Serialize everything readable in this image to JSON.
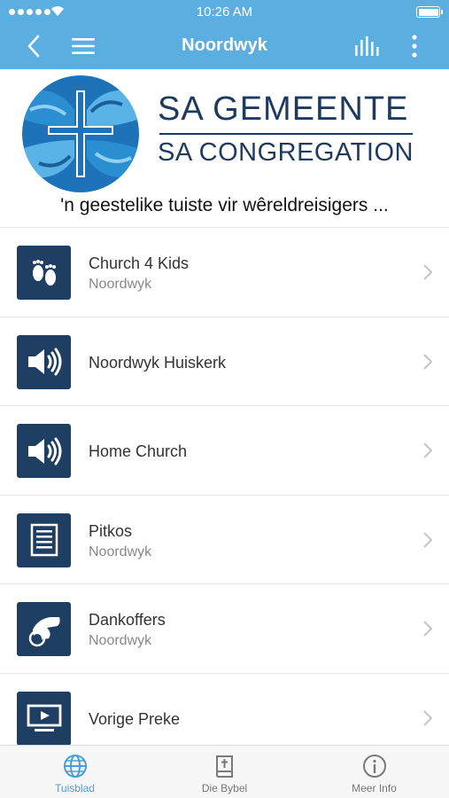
{
  "status_bar": {
    "time": "10:26 AM"
  },
  "nav": {
    "title": "Noordwyk",
    "icons": [
      "back-chevron-icon",
      "hamburger-menu-icon",
      "bar-chart-icon",
      "more-vertical-icon"
    ]
  },
  "header": {
    "brand_line1": "SA GEMEENTE",
    "brand_line2": "SA CONGREGATION",
    "tagline": "'n geestelike tuiste vir wêreldreisigers ..."
  },
  "list": [
    {
      "title": "Church 4 Kids",
      "subtitle": "Noordwyk",
      "icon": "footprints-icon"
    },
    {
      "title": "Noordwyk Huiskerk",
      "subtitle": "",
      "icon": "speaker-icon"
    },
    {
      "title": "Home Church",
      "subtitle": "",
      "icon": "speaker-icon"
    },
    {
      "title": "Pitkos",
      "subtitle": "Noordwyk",
      "icon": "document-icon"
    },
    {
      "title": "Dankoffers",
      "subtitle": "Noordwyk",
      "icon": "giving-hand-icon"
    },
    {
      "title": "Vorige Preke",
      "subtitle": "",
      "icon": "video-screen-icon"
    }
  ],
  "tabbar": {
    "tabs": [
      {
        "label": "Tuisblad",
        "icon": "globe-icon",
        "active": true
      },
      {
        "label": "Die Bybel",
        "icon": "bible-icon",
        "active": false
      },
      {
        "label": "Meer Info",
        "icon": "info-icon",
        "active": false
      }
    ]
  },
  "colors": {
    "nav_bar": "#5aaee0",
    "tile": "#1e3f63",
    "brand_text": "#1e3a5f",
    "tab_active": "#4a9fd8"
  }
}
